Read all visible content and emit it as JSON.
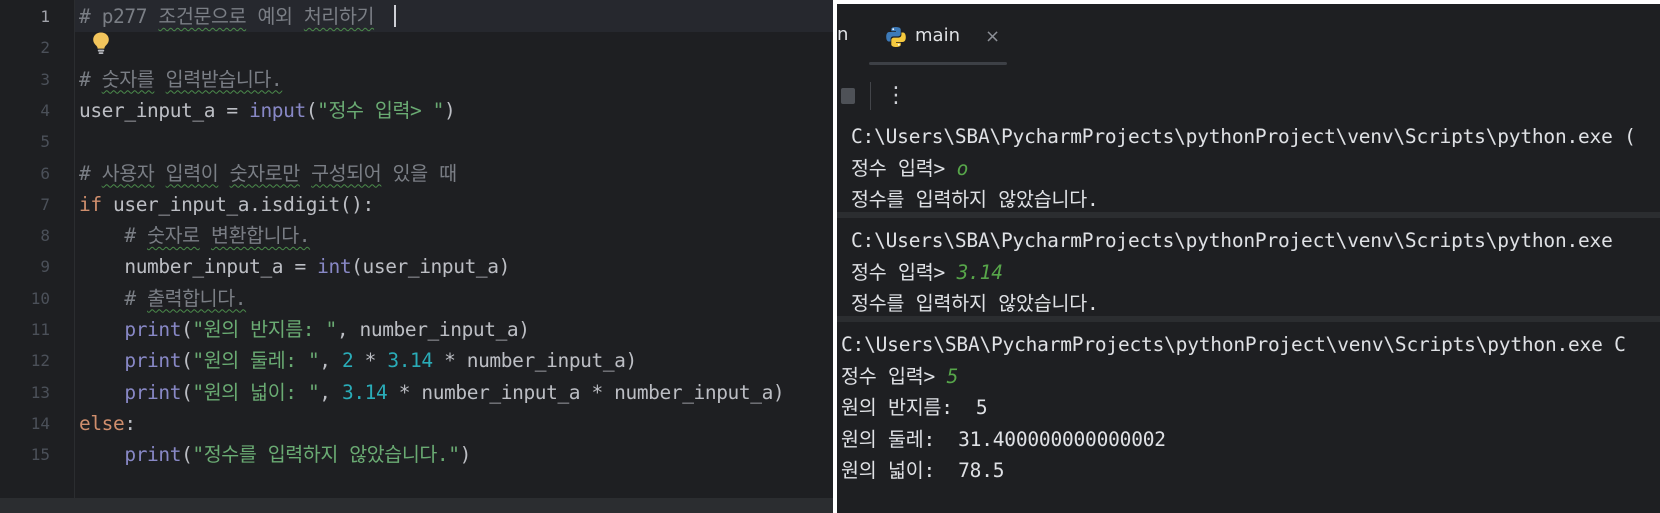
{
  "editor": {
    "current_line": 1,
    "line_numbers": [
      "1",
      "2",
      "3",
      "4",
      "5",
      "6",
      "7",
      "8",
      "9",
      "10",
      "11",
      "12",
      "13",
      "14",
      "15"
    ],
    "lines": [
      [
        {
          "t": "comment",
          "v": "# p277 조건문으로 예외 처리하기"
        }
      ],
      [],
      [
        {
          "t": "comment",
          "v": "# 숫자를 입력받습니다."
        }
      ],
      [
        {
          "t": "plain",
          "v": "user_input_a = "
        },
        {
          "t": "builtin",
          "v": "input"
        },
        {
          "t": "plain",
          "v": "("
        },
        {
          "t": "string",
          "v": "\"정수 입력> \""
        },
        {
          "t": "plain",
          "v": ")"
        }
      ],
      [],
      [
        {
          "t": "comment",
          "v": "# 사용자 입력이 숫자로만 구성되어 있을 때"
        }
      ],
      [
        {
          "t": "keyword",
          "v": "if "
        },
        {
          "t": "plain",
          "v": "user_input_a.isdigit():"
        }
      ],
      [
        {
          "t": "comment",
          "v": "    # 숫자로 변환합니다."
        }
      ],
      [
        {
          "t": "plain",
          "v": "    number_input_a = "
        },
        {
          "t": "builtin",
          "v": "int"
        },
        {
          "t": "plain",
          "v": "(user_input_a)"
        }
      ],
      [
        {
          "t": "comment",
          "v": "    # 출력합니다."
        }
      ],
      [
        {
          "t": "plain",
          "v": "    "
        },
        {
          "t": "builtin",
          "v": "print"
        },
        {
          "t": "plain",
          "v": "("
        },
        {
          "t": "string",
          "v": "\"원의 반지름: \""
        },
        {
          "t": "plain",
          "v": ", number_input_a)"
        }
      ],
      [
        {
          "t": "plain",
          "v": "    "
        },
        {
          "t": "builtin",
          "v": "print"
        },
        {
          "t": "plain",
          "v": "("
        },
        {
          "t": "string",
          "v": "\"원의 둘레: \""
        },
        {
          "t": "plain",
          "v": ", "
        },
        {
          "t": "number",
          "v": "2"
        },
        {
          "t": "plain",
          "v": " * "
        },
        {
          "t": "number",
          "v": "3.14"
        },
        {
          "t": "plain",
          "v": " * number_input_a)"
        }
      ],
      [
        {
          "t": "plain",
          "v": "    "
        },
        {
          "t": "builtin",
          "v": "print"
        },
        {
          "t": "plain",
          "v": "("
        },
        {
          "t": "string",
          "v": "\"원의 넓이: \""
        },
        {
          "t": "plain",
          "v": ", "
        },
        {
          "t": "number",
          "v": "3.14"
        },
        {
          "t": "plain",
          "v": " * number_input_a * number_input_a)"
        }
      ],
      [
        {
          "t": "keyword",
          "v": "else"
        },
        {
          "t": "plain",
          "v": ":"
        }
      ],
      [
        {
          "t": "plain",
          "v": "    "
        },
        {
          "t": "builtin",
          "v": "print"
        },
        {
          "t": "plain",
          "v": "("
        },
        {
          "t": "string",
          "v": "\"정수를 입력하지 않았습니다.\""
        },
        {
          "t": "plain",
          "v": ")"
        }
      ]
    ],
    "intention_icon": "lightbulb-icon"
  },
  "run": {
    "prev_tab_fragment": "n",
    "tab": {
      "label": "main",
      "icon": "python-icon",
      "close": "×"
    },
    "toolbar": {
      "stop_icon": "stop-icon",
      "more_icon": "⋮"
    },
    "blocks": [
      {
        "lines": [
          {
            "text": "C:\\Users\\SBA\\PycharmProjects\\pythonProject\\venv\\Scripts\\python.exe ("
          },
          {
            "text": "정수 입력> ",
            "input": "o"
          },
          {
            "text": "정수를 입력하지 않았습니다."
          }
        ]
      },
      {
        "lines": [
          {
            "text": "C:\\Users\\SBA\\PycharmProjects\\pythonProject\\venv\\Scripts\\python.exe"
          },
          {
            "text": "정수 입력> ",
            "input": "3.14"
          },
          {
            "text": "정수를 입력하지 않았습니다."
          }
        ]
      },
      {
        "lines": [
          {
            "text": "C:\\Users\\SBA\\PycharmProjects\\pythonProject\\venv\\Scripts\\python.exe C"
          },
          {
            "text": "정수 입력> ",
            "input": "5"
          },
          {
            "text": "원의 반지름:  5"
          },
          {
            "text": "원의 둘레:  31.400000000000002"
          },
          {
            "text": "원의 넓이:  78.5"
          }
        ]
      }
    ]
  },
  "colors": {
    "editor_bg": "#1e1f22",
    "comment": "#7a7e85",
    "keyword": "#cf8e6d",
    "builtin": "#8888c6",
    "string": "#6aab73",
    "number": "#2aacb8",
    "text": "#bcbec4",
    "user_input": "#57a64a"
  }
}
